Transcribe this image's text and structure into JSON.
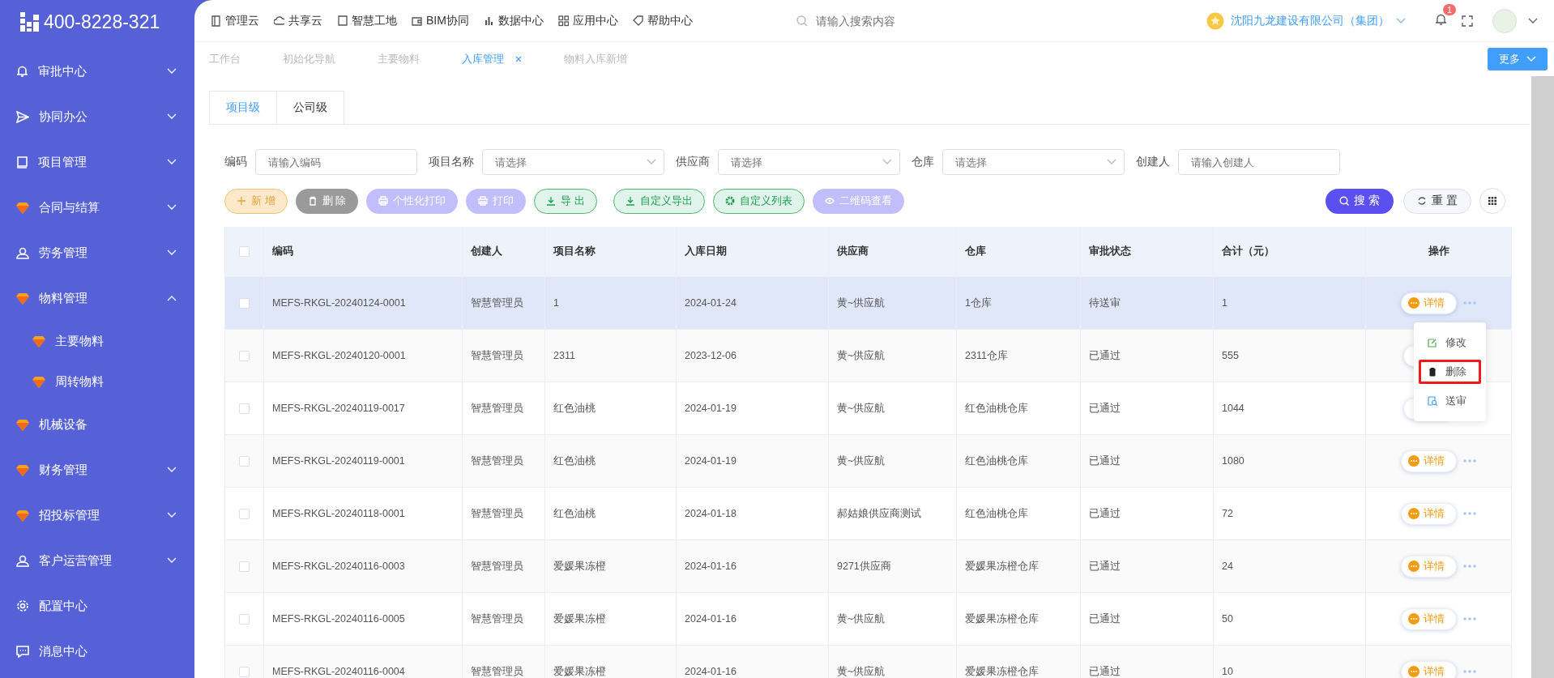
{
  "logo": {
    "phone": "400-8228-321"
  },
  "top_nav": [
    {
      "label": "管理云"
    },
    {
      "label": "共享云"
    },
    {
      "label": "智慧工地"
    },
    {
      "label": "BIM协同"
    },
    {
      "label": "数据中心"
    },
    {
      "label": "应用中心"
    },
    {
      "label": "帮助中心"
    }
  ],
  "search": {
    "placeholder": "请输入搜索内容"
  },
  "company": "沈阳九龙建设有限公司（集团）",
  "notifications": {
    "count": "1"
  },
  "sidebar": {
    "items": [
      {
        "label": "审批中心",
        "expanded": false
      },
      {
        "label": "协同办公",
        "expanded": false
      },
      {
        "label": "项目管理",
        "expanded": false
      },
      {
        "label": "合同与结算",
        "expanded": false
      },
      {
        "label": "劳务管理",
        "expanded": false
      },
      {
        "label": "物料管理",
        "expanded": true,
        "children": [
          {
            "label": "主要物料"
          },
          {
            "label": "周转物料"
          }
        ]
      },
      {
        "label": "机械设备"
      },
      {
        "label": "财务管理",
        "expanded": false
      },
      {
        "label": "招投标管理",
        "expanded": false
      },
      {
        "label": "客户运营管理",
        "expanded": false
      },
      {
        "label": "配置中心"
      },
      {
        "label": "消息中心"
      }
    ]
  },
  "page_tabs": [
    {
      "label": "工作台",
      "selected": false,
      "closable": false
    },
    {
      "label": "初始化导航",
      "selected": false,
      "closable": false
    },
    {
      "label": "主要物料",
      "selected": false,
      "closable": false
    },
    {
      "label": "入库管理",
      "selected": true,
      "closable": true
    },
    {
      "label": "物料入库新增",
      "selected": false,
      "closable": false
    }
  ],
  "more_button": "更多",
  "level_tabs": [
    {
      "label": "项目级",
      "selected": true
    },
    {
      "label": "公司级",
      "selected": false
    }
  ],
  "filters": [
    {
      "label": "编码",
      "placeholder": "请输入编码",
      "kind": "input"
    },
    {
      "label": "项目名称",
      "placeholder": "请选择",
      "kind": "select"
    },
    {
      "label": "供应商",
      "placeholder": "请选择",
      "kind": "select"
    },
    {
      "label": "仓库",
      "placeholder": "请选择",
      "kind": "select"
    },
    {
      "label": "创建人",
      "placeholder": "请输入创建人",
      "kind": "input"
    }
  ],
  "toolbar": [
    {
      "label": "新 增",
      "kind": "warning"
    },
    {
      "label": "删 除",
      "kind": "disabled"
    },
    {
      "label": "个性化打印",
      "kind": "purple"
    },
    {
      "label": "打印",
      "kind": "purple"
    },
    {
      "label": "导 出",
      "kind": "green"
    },
    {
      "label": "自定义导出",
      "kind": "green"
    },
    {
      "label": "自定义列表",
      "kind": "green"
    },
    {
      "label": "二维码查看",
      "kind": "purple"
    }
  ],
  "search_button": "搜 索",
  "reset_button": "重 置",
  "table": {
    "header_checked": false,
    "columns": [
      "编码",
      "创建人",
      "项目名称",
      "入库日期",
      "供应商",
      "仓库",
      "审批状态",
      "合计（元）",
      "操作"
    ],
    "rows": [
      {
        "checked": false,
        "highlighted": true,
        "cells": [
          "MEFS-RKGL-20240124-0001",
          "智慧管理员",
          "1",
          "2024-01-24",
          "黄~供应航",
          "1仓库",
          "待送审",
          "1"
        ],
        "action": "详情"
      },
      {
        "checked": false,
        "highlighted": false,
        "cells": [
          "MEFS-RKGL-20240120-0001",
          "智慧管理员",
          "2311",
          "2023-12-06",
          "黄~供应航",
          "2311仓库",
          "已通过",
          "555"
        ]
      },
      {
        "checked": false,
        "highlighted": false,
        "cells": [
          "MEFS-RKGL-20240119-0017",
          "智慧管理员",
          "红色油桃",
          "2024-01-19",
          "黄~供应航",
          "红色油桃仓库",
          "已通过",
          "1044"
        ]
      },
      {
        "checked": false,
        "highlighted": false,
        "cells": [
          "MEFS-RKGL-20240119-0001",
          "智慧管理员",
          "红色油桃",
          "2024-01-19",
          "黄~供应航",
          "红色油桃仓库",
          "已通过",
          "1080"
        ],
        "action": "详情"
      },
      {
        "checked": false,
        "highlighted": false,
        "cells": [
          "MEFS-RKGL-20240118-0001",
          "智慧管理员",
          "红色油桃",
          "2024-01-18",
          "郝姑娘供应商测试",
          "红色油桃仓库",
          "已通过",
          "72"
        ],
        "action": "详情"
      },
      {
        "checked": false,
        "highlighted": false,
        "cells": [
          "MEFS-RKGL-20240116-0003",
          "智慧管理员",
          "爱媛果冻橙",
          "2024-01-16",
          "9271供应商",
          "爱媛果冻橙仓库",
          "已通过",
          "24"
        ],
        "action": "详情"
      },
      {
        "checked": false,
        "highlighted": false,
        "cells": [
          "MEFS-RKGL-20240116-0005",
          "智慧管理员",
          "爱媛果冻橙",
          "2024-01-16",
          "黄~供应航",
          "爱媛果冻橙仓库",
          "已通过",
          "50"
        ],
        "action": "详情"
      },
      {
        "checked": false,
        "highlighted": false,
        "cells": [
          "MEFS-RKGL-20240116-0004",
          "智慧管理员",
          "爱媛果冻橙",
          "2024-01-16",
          "黄~供应航",
          "爱媛果冻橙仓库",
          "已通过",
          "10"
        ],
        "action": "详情"
      }
    ]
  },
  "row_menu": {
    "items": [
      {
        "label": "修改",
        "highlighted": false
      },
      {
        "label": "删除",
        "highlighted": true
      },
      {
        "label": "送审",
        "highlighted": false
      }
    ]
  }
}
